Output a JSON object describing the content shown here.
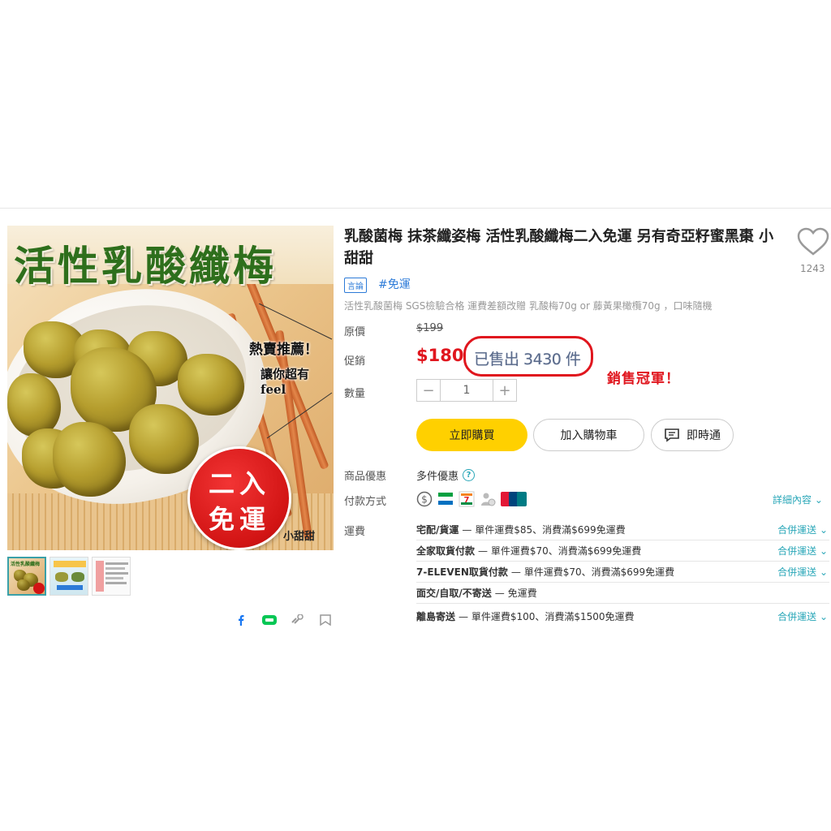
{
  "image": {
    "headline": "活性乳酸纖梅",
    "hot_line": "熱賣推薦！",
    "feel_line": "讓你超有feel",
    "badge_line1": "二入",
    "badge_line2": "免運",
    "brand": "小甜甜",
    "thumb_title": "活性乳酸纖梅"
  },
  "product": {
    "title": "乳酸菌梅 抹茶纖姿梅 活性乳酸纖梅二入免運 另有奇亞籽蜜黑棗 小甜甜",
    "like_count": "1243",
    "tag_label": "言論",
    "hashtag": "#免運",
    "subtitle": "活性乳酸菌梅 SGS檢驗合格 運費差額改贈 乳酸梅70g or 藤黃果橄欖70g ，口味隨機"
  },
  "labels": {
    "original_price": "原價",
    "sale": "促銷",
    "quantity": "數量",
    "promotions": "商品優惠",
    "payment": "付款方式",
    "shipping": "運費"
  },
  "price": {
    "original": "$199",
    "sale": "$180",
    "sold": "已售出 3430 件",
    "annotation": "銷售冠軍！"
  },
  "quantity": {
    "minus": "−",
    "value": "1",
    "plus": "+"
  },
  "buttons": {
    "buy": "立即購買",
    "cart": "加入購物車",
    "chat": "即時通"
  },
  "promotions": {
    "text": "多件優惠",
    "help": "?"
  },
  "payment": {
    "detail_link": "詳細內容",
    "icons": [
      "cash-icon",
      "familymart-icon",
      "seven-eleven-icon",
      "face-to-face-icon",
      "unionpay-icon"
    ]
  },
  "shipping": [
    {
      "method": "宅配/貨運",
      "desc": "— 單件運費$85、消費滿$699免運費",
      "link": "合併運送"
    },
    {
      "method": "全家取貨付款",
      "desc": "— 單件運費$70、消費滿$699免運費",
      "link": "合併運送"
    },
    {
      "method": "7-ELEVEN取貨付款",
      "desc": "— 單件運費$70、消費滿$699免運費",
      "link": "合併運送"
    },
    {
      "method": "面交/自取/不寄送",
      "desc": "— 免運費",
      "link": ""
    },
    {
      "method": "離島寄送",
      "desc": "— 單件運費$100、消費滿$1500免運費",
      "link": "合併運送"
    }
  ],
  "colors": {
    "accent": "#ffd000",
    "sale_red": "#e0161e",
    "link_teal": "#2aa7b8",
    "link_blue": "#2d7bd8"
  }
}
